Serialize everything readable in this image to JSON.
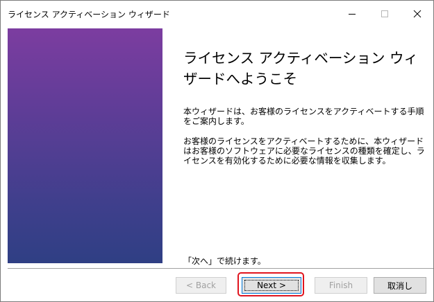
{
  "window": {
    "title": "ライセンス アクティベーション ウィザード"
  },
  "wizard": {
    "heading": "ライセンス アクティベーション ウィザードへようこそ",
    "paragraph1": "本ウィザードは、お客様のライセンスをアクティベートする手順をご案内します。",
    "paragraph2": "お客様のライセンスをアクティベートするために、本ウィザードはお客様のソフトウェアに必要なライセンスの種類を確定し、ライセンスを有効化するために必要な情報を収集します。",
    "continue_hint": "「次へ」で続けます。"
  },
  "buttons": {
    "back": "< Back",
    "next": "Next >",
    "finish": "Finish",
    "cancel": "取消し"
  },
  "colors": {
    "sidebar_top": "#7c3da0",
    "sidebar_bottom": "#2f3f84",
    "highlight": "#e0141e",
    "focus_border": "#0078d7"
  },
  "icons": {
    "minimize": "minimize-icon",
    "maximize": "maximize-icon",
    "close": "close-icon"
  }
}
